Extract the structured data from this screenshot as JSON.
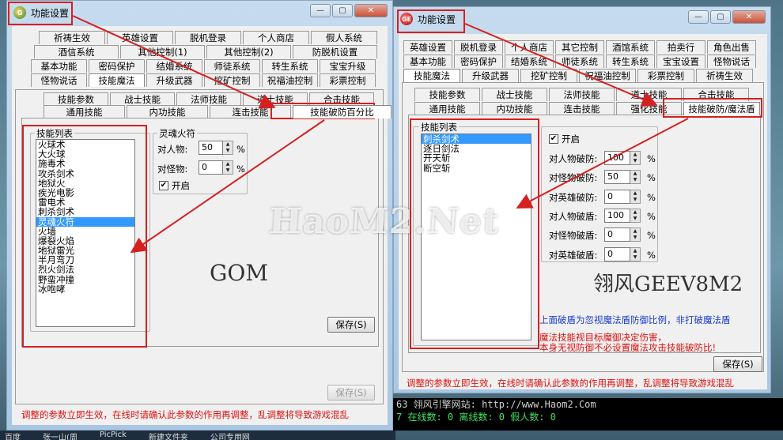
{
  "left_window": {
    "title": "功能设置",
    "tab_rows": [
      [
        "祈祷生效",
        "英雄设置",
        "脱机登录",
        "个人商店",
        "假人系统"
      ],
      [
        "酒信系统",
        "其他控制(1)",
        "其他控制(2)",
        "防脱机设置"
      ],
      [
        "基本功能",
        "密码保护",
        "结婚系统",
        "师徒系统",
        "转生系统",
        "宝宝升级"
      ],
      [
        "怪物说话",
        "技能魔法",
        "升级武器",
        "挖矿控制",
        "祝福油控制",
        "彩票控制"
      ]
    ],
    "sub_tab_rows": [
      [
        "技能参数",
        "战士技能",
        "法师技能",
        "道士技能",
        "合击技能"
      ],
      [
        "通用技能",
        "内功技能",
        "连击技能",
        "技能破防百分比"
      ]
    ],
    "skill_list_title": "技能列表",
    "skills": [
      "火球术",
      "大火球",
      "施毒术",
      "攻杀剑术",
      "地狱火",
      "疾光电影",
      "雷电术",
      "刺杀剑术",
      "灵魂火符",
      "火墙",
      "爆裂火焰",
      "地狱雷光",
      "半月弯刀",
      "烈火剑法",
      "野蛮冲撞",
      "冰咆哮"
    ],
    "selected_skill": "灵魂火符",
    "group_title": "灵魂火符",
    "fields": [
      {
        "label": "对人物:",
        "value": "50",
        "unit": "%"
      },
      {
        "label": "对怪物:",
        "value": "0",
        "unit": "%"
      }
    ],
    "enable_label": "开启",
    "enable_checked": "✔",
    "save_label": "保存(S)",
    "save2_label": "保存(S)",
    "watermark": "GOM",
    "footer_note": "调整的参数立即生效，在线时请确认此参数的作用再调整，乱调整将导致游戏混乱"
  },
  "right_window": {
    "title": "功能设置",
    "tab_rows": [
      [
        "英雄设置",
        "脱机登录",
        "个人商店",
        "其它控制",
        "酒馆系统",
        "拍卖行",
        "角色出售"
      ],
      [
        "基本功能",
        "密码保护",
        "结婚系统",
        "师徒系统",
        "转生系统",
        "宝宝设置",
        "怪物说话"
      ],
      [
        "技能魔法",
        "升级武器",
        "挖矿控制",
        "祝福油控制",
        "彩票控制",
        "祈祷生效"
      ]
    ],
    "sub_tab_rows": [
      [
        "技能参数",
        "战士技能",
        "法师技能",
        "道士技能",
        "合击技能"
      ],
      [
        "通用技能",
        "内功技能",
        "连击技能",
        "强化技能",
        "技能破防/魔法盾"
      ]
    ],
    "skill_list_title": "技能列表",
    "skills": [
      "刺杀剑术",
      "逐日剑法",
      "开天斩",
      "断空斩"
    ],
    "selected_skill": "刺杀剑术",
    "enable_label": "开启",
    "enable_checked": "✔",
    "fields": [
      {
        "label": "对人物破防:",
        "value": "100",
        "unit": "%"
      },
      {
        "label": "对怪物破防:",
        "value": "50",
        "unit": "%"
      },
      {
        "label": "对英雄破防:",
        "value": "0",
        "unit": "%"
      },
      {
        "label": "对人物破盾:",
        "value": "100",
        "unit": "%"
      },
      {
        "label": "对怪物破盾:",
        "value": "0",
        "unit": "%"
      },
      {
        "label": "对英雄破盾:",
        "value": "0",
        "unit": "%"
      }
    ],
    "watermark": "翎风GEEV8M2",
    "blue_note": "上面破盾为忽视魔法盾防御比例，非打破魔法盾",
    "red_note_1": "魔法技能视目标魔御决定伤害，",
    "red_note_2": "本身无视防御不必设置魔法攻击技能破防比!",
    "save_label": "保存(S)",
    "footer_note": "调整的参数立即生效，在线时请确认此参数的作用再调整，乱调整将导致游戏混乱"
  },
  "console": {
    "line1": "63  翎风引擎网站: http://www.Haom2.Com",
    "line2": "7  在线数: 0  离线数: 0  假人数: 0"
  },
  "taskbar_items": [
    "百度",
    "张一山(周",
    "PicPick",
    "新建文件夹",
    "公司专用网"
  ],
  "site_watermark": "HaoM2.Net",
  "colors": {
    "highlight": "#d62020",
    "selection": "#3399ff",
    "note_blue": "#1a3ad0",
    "note_red": "#e01010"
  }
}
